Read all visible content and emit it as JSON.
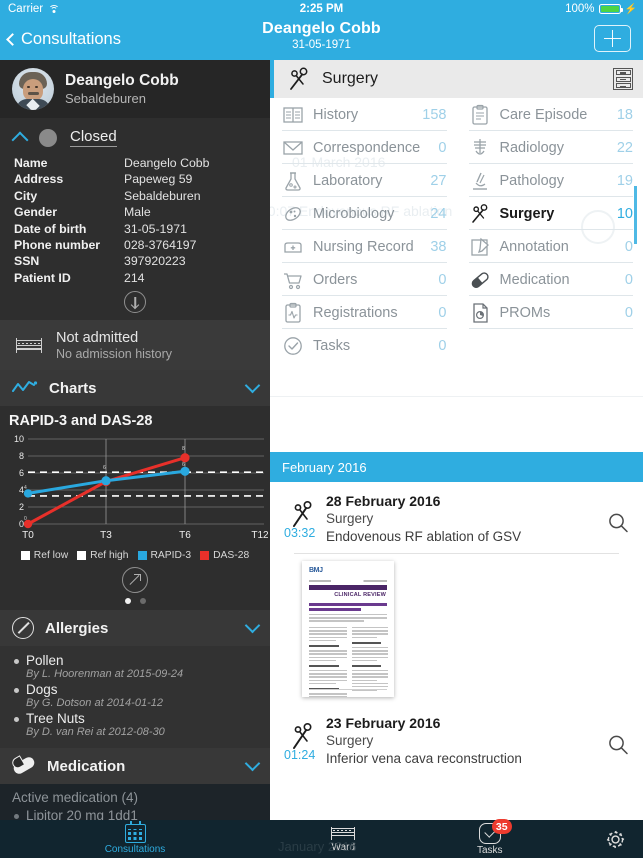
{
  "statusbar": {
    "carrier": "Carrier",
    "wifi_icon": "wifi-icon",
    "time": "2:25 PM",
    "battery_pct": "100%",
    "battery_icon": "battery-full-icon"
  },
  "navbar": {
    "back_label": "Consultations",
    "back_icon": "chevron-left-icon",
    "title": "Deangelo Cobb",
    "subtitle": "31-05-1971",
    "add_icon": "plus-icon"
  },
  "sidebar": {
    "patient": {
      "name": "Deangelo Cobb",
      "city": "Sebaldeburen",
      "avatar": "patient-avatar"
    },
    "status": {
      "label": "Closed",
      "collapse_icon": "chevron-up-icon",
      "dot": "status-dot-grey"
    },
    "details": [
      {
        "key": "Name",
        "value": "Deangelo Cobb"
      },
      {
        "key": "Address",
        "value": "Papeweg 59"
      },
      {
        "key": "City",
        "value": "Sebaldeburen"
      },
      {
        "key": "Gender",
        "value": "Male"
      },
      {
        "key": "Date of birth",
        "value": "31-05-1971"
      },
      {
        "key": "Phone number",
        "value": "028-3764197"
      },
      {
        "key": "SSN",
        "value": "397920223"
      },
      {
        "key": "Patient ID",
        "value": "214"
      }
    ],
    "more_icon": "arrow-down-circle-icon",
    "admission": {
      "icon": "bed-icon",
      "title": "Not admitted",
      "subtitle": "No admission history"
    },
    "charts_section": {
      "title": "Charts",
      "icon": "line-chart-icon",
      "expand_icon": "chevron-down-icon",
      "open_icon": "arrow-expand-icon"
    },
    "pager": {
      "count": 2,
      "active": 0
    },
    "allergies_section": {
      "title": "Allergies",
      "icon": "no-entry-icon",
      "expand_icon": "chevron-down-icon"
    },
    "allergies": [
      {
        "name": "Pollen",
        "by": "By L. Hoorenman at 2015-09-24"
      },
      {
        "name": "Dogs",
        "by": "By G. Dotson at 2014-01-12"
      },
      {
        "name": "Tree Nuts",
        "by": "By D. van Rei at 2012-08-30"
      }
    ],
    "medication_section": {
      "title": "Medication",
      "icon": "pill-icon",
      "expand_icon": "chevron-down-icon"
    },
    "medication": {
      "heading": "Active medication (4)",
      "first_item": "Lipitor 20 mg 1dd1"
    }
  },
  "chart_data": {
    "type": "line",
    "title": "RAPID-3 and DAS-28",
    "xlabel": "",
    "ylabel": "",
    "categories": [
      "T0",
      "T3",
      "T6",
      "T12"
    ],
    "x_ticks": [
      "T0",
      "T3",
      "T6",
      "T12"
    ],
    "y_ticks": [
      0,
      2,
      4,
      6,
      8,
      10
    ],
    "ylim": [
      0,
      10
    ],
    "grid": true,
    "legend_position": "bottom",
    "reference_lines": [
      {
        "name": "Ref high",
        "value": 6.1,
        "color": "#ffffff",
        "style": "dashed"
      },
      {
        "name": "Ref low",
        "value": 3.3,
        "color": "#ffffff",
        "style": "dashed"
      }
    ],
    "series": [
      {
        "name": "RAPID-3",
        "color": "#29A8DF",
        "values": [
          3.6,
          5.1,
          6.2,
          null
        ],
        "point_labels": [
          "4",
          "",
          "6",
          ""
        ]
      },
      {
        "name": "DAS-28",
        "color": "#E8302A",
        "values": [
          0,
          5.0,
          7.8,
          null
        ],
        "point_labels": [
          "0",
          "",
          "8",
          ""
        ]
      }
    ],
    "legend": [
      "Ref low",
      "Ref high",
      "RAPID-3",
      "DAS-28"
    ],
    "legend_colors": [
      "#ffffff",
      "#ffffff",
      "#29A8DF",
      "#E8302A"
    ]
  },
  "main": {
    "header": {
      "title": "Surgery",
      "icon": "scissors-icon",
      "cabinet_icon": "file-cabinet-icon"
    },
    "ghost_texts": {
      "date": "01 March 2016",
      "entry": "00:07  Endovenous RF ablation",
      "month": "January 2016"
    },
    "categories_left": [
      {
        "label": "History",
        "count": "158",
        "icon": "book-icon",
        "active": false
      },
      {
        "label": "Correspondence",
        "count": "0",
        "icon": "envelope-icon",
        "active": false
      },
      {
        "label": "Laboratory",
        "count": "27",
        "icon": "flask-icon",
        "active": false
      },
      {
        "label": "Microbiology",
        "count": "24",
        "icon": "microbe-icon",
        "active": false
      },
      {
        "label": "Nursing Record",
        "count": "38",
        "icon": "nurse-hat-icon",
        "active": false
      },
      {
        "label": "Orders",
        "count": "0",
        "icon": "shopping-cart-icon",
        "active": false
      },
      {
        "label": "Registrations",
        "count": "0",
        "icon": "clipboard-pulse-icon",
        "active": false
      },
      {
        "label": "Tasks",
        "count": "0",
        "icon": "check-circle-icon",
        "active": false
      }
    ],
    "categories_right": [
      {
        "label": "Care Episode",
        "count": "18",
        "icon": "clipboard-icon",
        "active": false
      },
      {
        "label": "Radiology",
        "count": "22",
        "icon": "xray-icon",
        "active": false
      },
      {
        "label": "Pathology",
        "count": "19",
        "icon": "microscope-icon",
        "active": false
      },
      {
        "label": "Surgery",
        "count": "10",
        "icon": "scissors-icon",
        "active": true
      },
      {
        "label": "Annotation",
        "count": "0",
        "icon": "pencil-note-icon",
        "active": false
      },
      {
        "label": "Medication",
        "count": "0",
        "icon": "pill-icon",
        "active": false
      },
      {
        "label": "PROMs",
        "count": "0",
        "icon": "document-pie-icon",
        "active": false
      }
    ],
    "month_header": "February 2016",
    "entries": [
      {
        "time": "03:32",
        "date": "28 February 2016",
        "type": "Surgery",
        "description": "Endovenous RF ablation of GSV",
        "icon": "scissors-icon",
        "search_icon": "magnifier-icon"
      },
      {
        "time": "01:24",
        "date": "23 February 2016",
        "type": "Surgery",
        "description": "Inferior vena cava reconstruction",
        "icon": "scissors-icon",
        "search_icon": "magnifier-icon"
      }
    ],
    "thumbnail": {
      "brand": "BMJ",
      "label": "CLINICAL REVIEW",
      "name": "document-thumbnail"
    }
  },
  "tabbar": [
    {
      "label": "Consultations",
      "icon": "calendar-icon",
      "active": true,
      "badge": ""
    },
    {
      "label": "Ward",
      "icon": "bed-icon",
      "active": false,
      "badge": ""
    },
    {
      "label": "Tasks",
      "icon": "check-icon",
      "active": false,
      "badge": "35"
    },
    {
      "label": "",
      "icon": "gear-icon",
      "active": false,
      "badge": ""
    }
  ],
  "colors": {
    "accent": "#2FADE0",
    "dark_panel": "#2e2e2e",
    "tabbar": "#11252f",
    "badge": "#ED3B2E",
    "rapid3": "#29A8DF",
    "das28": "#E8302A"
  }
}
